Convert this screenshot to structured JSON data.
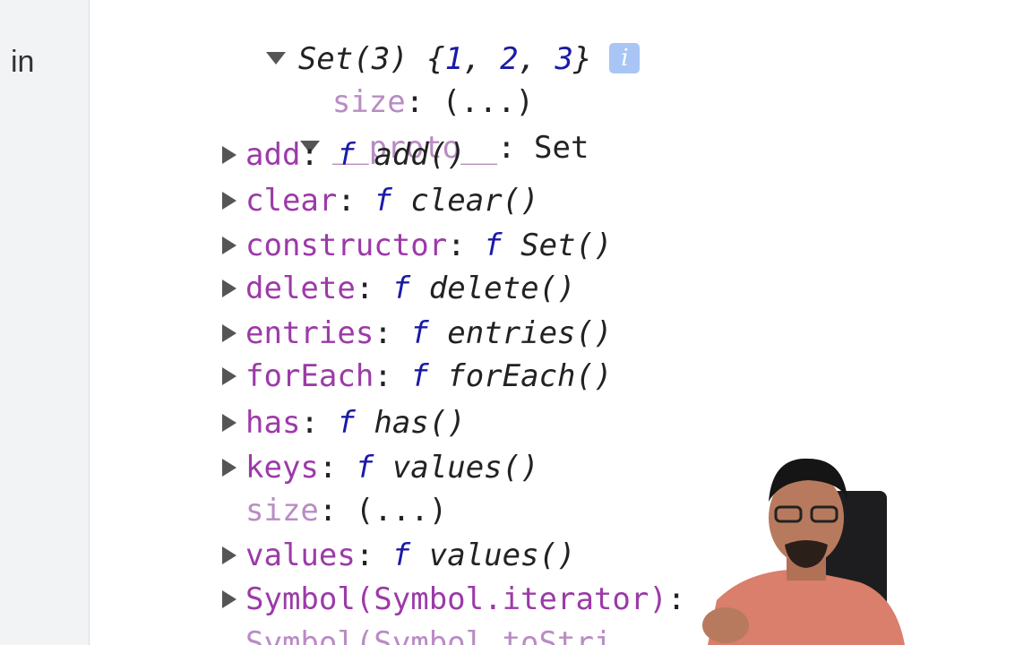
{
  "left_panel": {
    "label": "in"
  },
  "console": {
    "root": {
      "label": "Set(3)",
      "values_open": "{",
      "values": [
        "1",
        "2",
        "3"
      ],
      "values_close": "}",
      "info_badge": "i"
    },
    "size_row": {
      "key": "size",
      "value": "(...)"
    },
    "proto_row": {
      "key": "__proto__",
      "value": "Set"
    },
    "proto_items": [
      {
        "key": "add",
        "fn_symbol": "f",
        "fn_name": "add()",
        "expandable": true
      },
      {
        "key": "clear",
        "fn_symbol": "f",
        "fn_name": "clear()",
        "expandable": true
      },
      {
        "key": "constructor",
        "fn_symbol": "f",
        "fn_name": "Set()",
        "expandable": true
      },
      {
        "key": "delete",
        "fn_symbol": "f",
        "fn_name": "delete()",
        "expandable": true
      },
      {
        "key": "entries",
        "fn_symbol": "f",
        "fn_name": "entries()",
        "expandable": true
      },
      {
        "key": "forEach",
        "fn_symbol": "f",
        "fn_name": "forEach()",
        "expandable": true
      },
      {
        "key": "has",
        "fn_symbol": "f",
        "fn_name": "has()",
        "expandable": true
      },
      {
        "key": "keys",
        "fn_symbol": "f",
        "fn_name": "values()",
        "expandable": true
      },
      {
        "key": "size",
        "fn_symbol": "",
        "fn_name": "(...)",
        "expandable": false
      },
      {
        "key": "values",
        "fn_symbol": "f",
        "fn_name": "values()",
        "expandable": true
      },
      {
        "key": "Symbol(Symbol.iterator)",
        "fn_symbol": "",
        "fn_name": "",
        "expandable": true
      },
      {
        "key": "Symbol(Symbol.toStri",
        "fn_symbol": "",
        "fn_name": "",
        "expandable": false
      }
    ]
  },
  "colors": {
    "key": "#9c3aa8",
    "function_keyword": "#1a1aa6",
    "number": "#1a1aa6",
    "info_badge": "#a9c5f5",
    "panel_bg": "#f1f3f4"
  }
}
